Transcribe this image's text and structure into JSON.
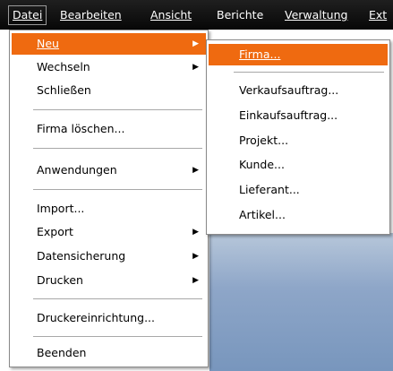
{
  "menubar": {
    "items": [
      "Datei",
      "Bearbeiten",
      "Ansicht",
      "Berichte",
      "Verwaltung",
      "Ext"
    ]
  },
  "file_menu": {
    "items": [
      {
        "label": "Neu",
        "has_submenu": true,
        "highlighted": true
      },
      {
        "label": "Wechseln",
        "has_submenu": true
      },
      {
        "label": "Schließen"
      },
      {
        "label": "Firma löschen..."
      },
      {
        "label": "Anwendungen",
        "has_submenu": true
      },
      {
        "label": "Import..."
      },
      {
        "label": "Export",
        "has_submenu": true
      },
      {
        "label": "Datensicherung",
        "has_submenu": true
      },
      {
        "label": "Drucken",
        "has_submenu": true
      },
      {
        "label": "Druckereinrichtung..."
      },
      {
        "label": "Beenden"
      }
    ]
  },
  "new_submenu": {
    "items": [
      {
        "label": "Firma...",
        "highlighted": true
      },
      {
        "label": "Verkaufsauftrag..."
      },
      {
        "label": "Einkaufsauftrag..."
      },
      {
        "label": "Projekt..."
      },
      {
        "label": "Kunde..."
      },
      {
        "label": "Lieferant..."
      },
      {
        "label": "Artikel..."
      }
    ]
  },
  "colors": {
    "highlight": "#ef6a10",
    "menubar": "#0b0b0b"
  },
  "icons": {
    "submenu_arrow": "chevron-right-icon"
  }
}
